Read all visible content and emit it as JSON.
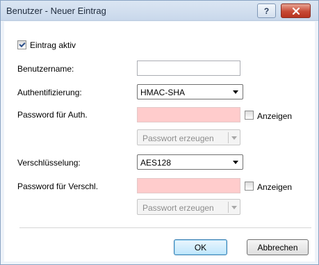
{
  "window": {
    "title": "Benutzer - Neuer Eintrag",
    "help_label": "?",
    "close_label": "✕"
  },
  "form": {
    "active": {
      "label": "Eintrag aktiv",
      "checked": true
    },
    "username": {
      "label": "Benutzername:",
      "value": ""
    },
    "auth": {
      "label": "Authentifizierung:",
      "selected": "HMAC-SHA"
    },
    "auth_password": {
      "label": "Password für Auth.",
      "value": "",
      "show_label": "Anzeigen",
      "show_checked": false,
      "generate_label": "Passwort erzeugen"
    },
    "encryption": {
      "label": "Verschlüsselung:",
      "selected": "AES128"
    },
    "enc_password": {
      "label": "Password für Verschl.",
      "value": "",
      "show_label": "Anzeigen",
      "show_checked": false,
      "generate_label": "Passwort erzeugen"
    }
  },
  "buttons": {
    "ok": "OK",
    "cancel": "Abbrechen"
  },
  "colors": {
    "required_field": "#ffcccc",
    "close_button": "#c74a36"
  }
}
